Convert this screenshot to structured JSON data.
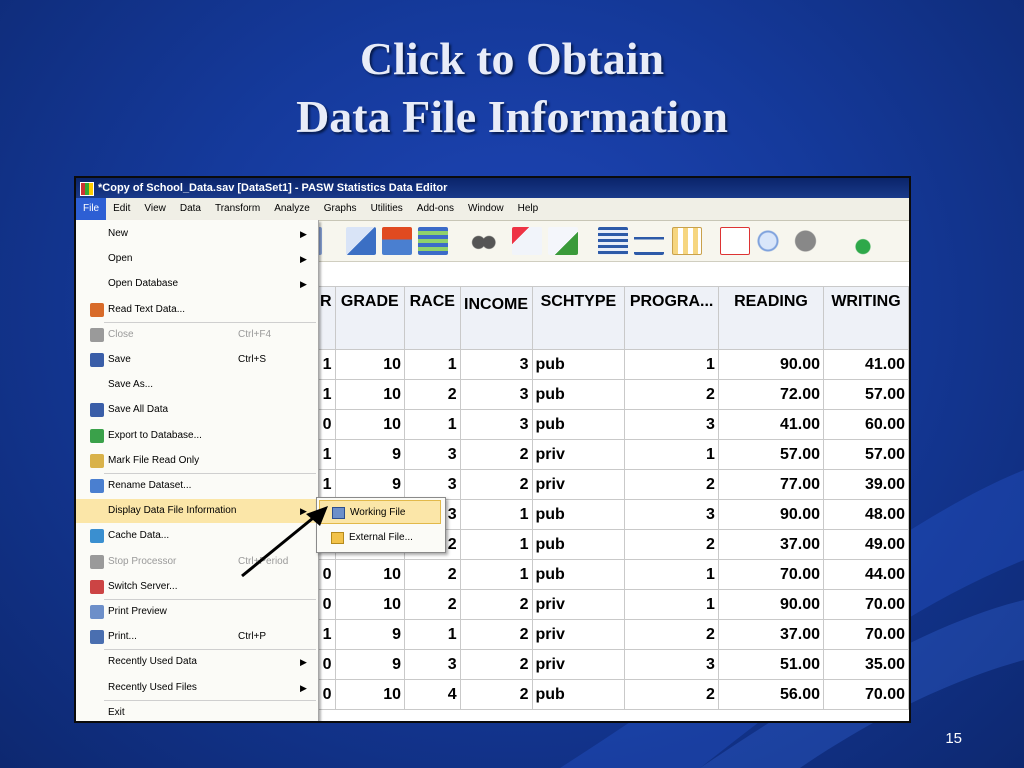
{
  "slide": {
    "title_line1": "Click to Obtain",
    "title_line2": "Data File Information",
    "page_number": "15"
  },
  "window": {
    "title": "*Copy of School_Data.sav [DataSet1] - PASW Statistics Data Editor"
  },
  "menubar": [
    "File",
    "Edit",
    "View",
    "Data",
    "Transform",
    "Analyze",
    "Graphs",
    "Utilities",
    "Add-ons",
    "Window",
    "Help"
  ],
  "file_menu": [
    {
      "label": "New",
      "arrow": "▶"
    },
    {
      "label": "Open",
      "arrow": "▶"
    },
    {
      "label": "Open Database",
      "arrow": "▶"
    },
    {
      "label": "Read Text Data..."
    },
    {
      "label": "Close",
      "shortcut": "Ctrl+F4"
    },
    {
      "label": "Save",
      "shortcut": "Ctrl+S"
    },
    {
      "label": "Save As..."
    },
    {
      "label": "Save All Data"
    },
    {
      "label": "Export to Database..."
    },
    {
      "label": "Mark File Read Only"
    },
    {
      "label": "Rename Dataset..."
    },
    {
      "label": "Display Data File Information",
      "arrow": "▶"
    },
    {
      "label": "Cache Data..."
    },
    {
      "label": "Stop Processor",
      "shortcut": "Ctrl+Period"
    },
    {
      "label": "Switch Server..."
    },
    {
      "label": "Print Preview"
    },
    {
      "label": "Print...",
      "shortcut": "Ctrl+P"
    },
    {
      "label": "Recently Used Data",
      "arrow": "▶"
    },
    {
      "label": "Recently Used Files",
      "arrow": "▶"
    },
    {
      "label": "Exit"
    }
  ],
  "submenu": [
    {
      "label": "Working File"
    },
    {
      "label": "External File..."
    }
  ],
  "grid": {
    "headers": [
      "R",
      "GRADE",
      "RACE",
      "INCOME",
      "SCHTYPE",
      "PROGRA...",
      "READING",
      "WRITING"
    ],
    "rows": [
      [
        "1",
        "10",
        "1",
        "3",
        "pub",
        "1",
        "90.00",
        "41.00"
      ],
      [
        "1",
        "10",
        "2",
        "3",
        "pub",
        "2",
        "72.00",
        "57.00"
      ],
      [
        "0",
        "10",
        "1",
        "3",
        "pub",
        "3",
        "41.00",
        "60.00"
      ],
      [
        "1",
        "9",
        "3",
        "2",
        "priv",
        "1",
        "57.00",
        "57.00"
      ],
      [
        "1",
        "9",
        "3",
        "2",
        "priv",
        "2",
        "77.00",
        "39.00"
      ],
      [
        "",
        "",
        "3",
        "1",
        "pub",
        "3",
        "90.00",
        "48.00"
      ],
      [
        "",
        "",
        "2",
        "1",
        "pub",
        "2",
        "37.00",
        "49.00"
      ],
      [
        "0",
        "10",
        "2",
        "1",
        "pub",
        "1",
        "70.00",
        "44.00"
      ],
      [
        "0",
        "10",
        "2",
        "2",
        "priv",
        "1",
        "90.00",
        "70.00"
      ],
      [
        "1",
        "9",
        "1",
        "2",
        "priv",
        "2",
        "37.00",
        "70.00"
      ],
      [
        "0",
        "9",
        "3",
        "2",
        "priv",
        "3",
        "51.00",
        "35.00"
      ],
      [
        "0",
        "10",
        "4",
        "2",
        "pub",
        "2",
        "56.00",
        "70.00"
      ]
    ]
  }
}
